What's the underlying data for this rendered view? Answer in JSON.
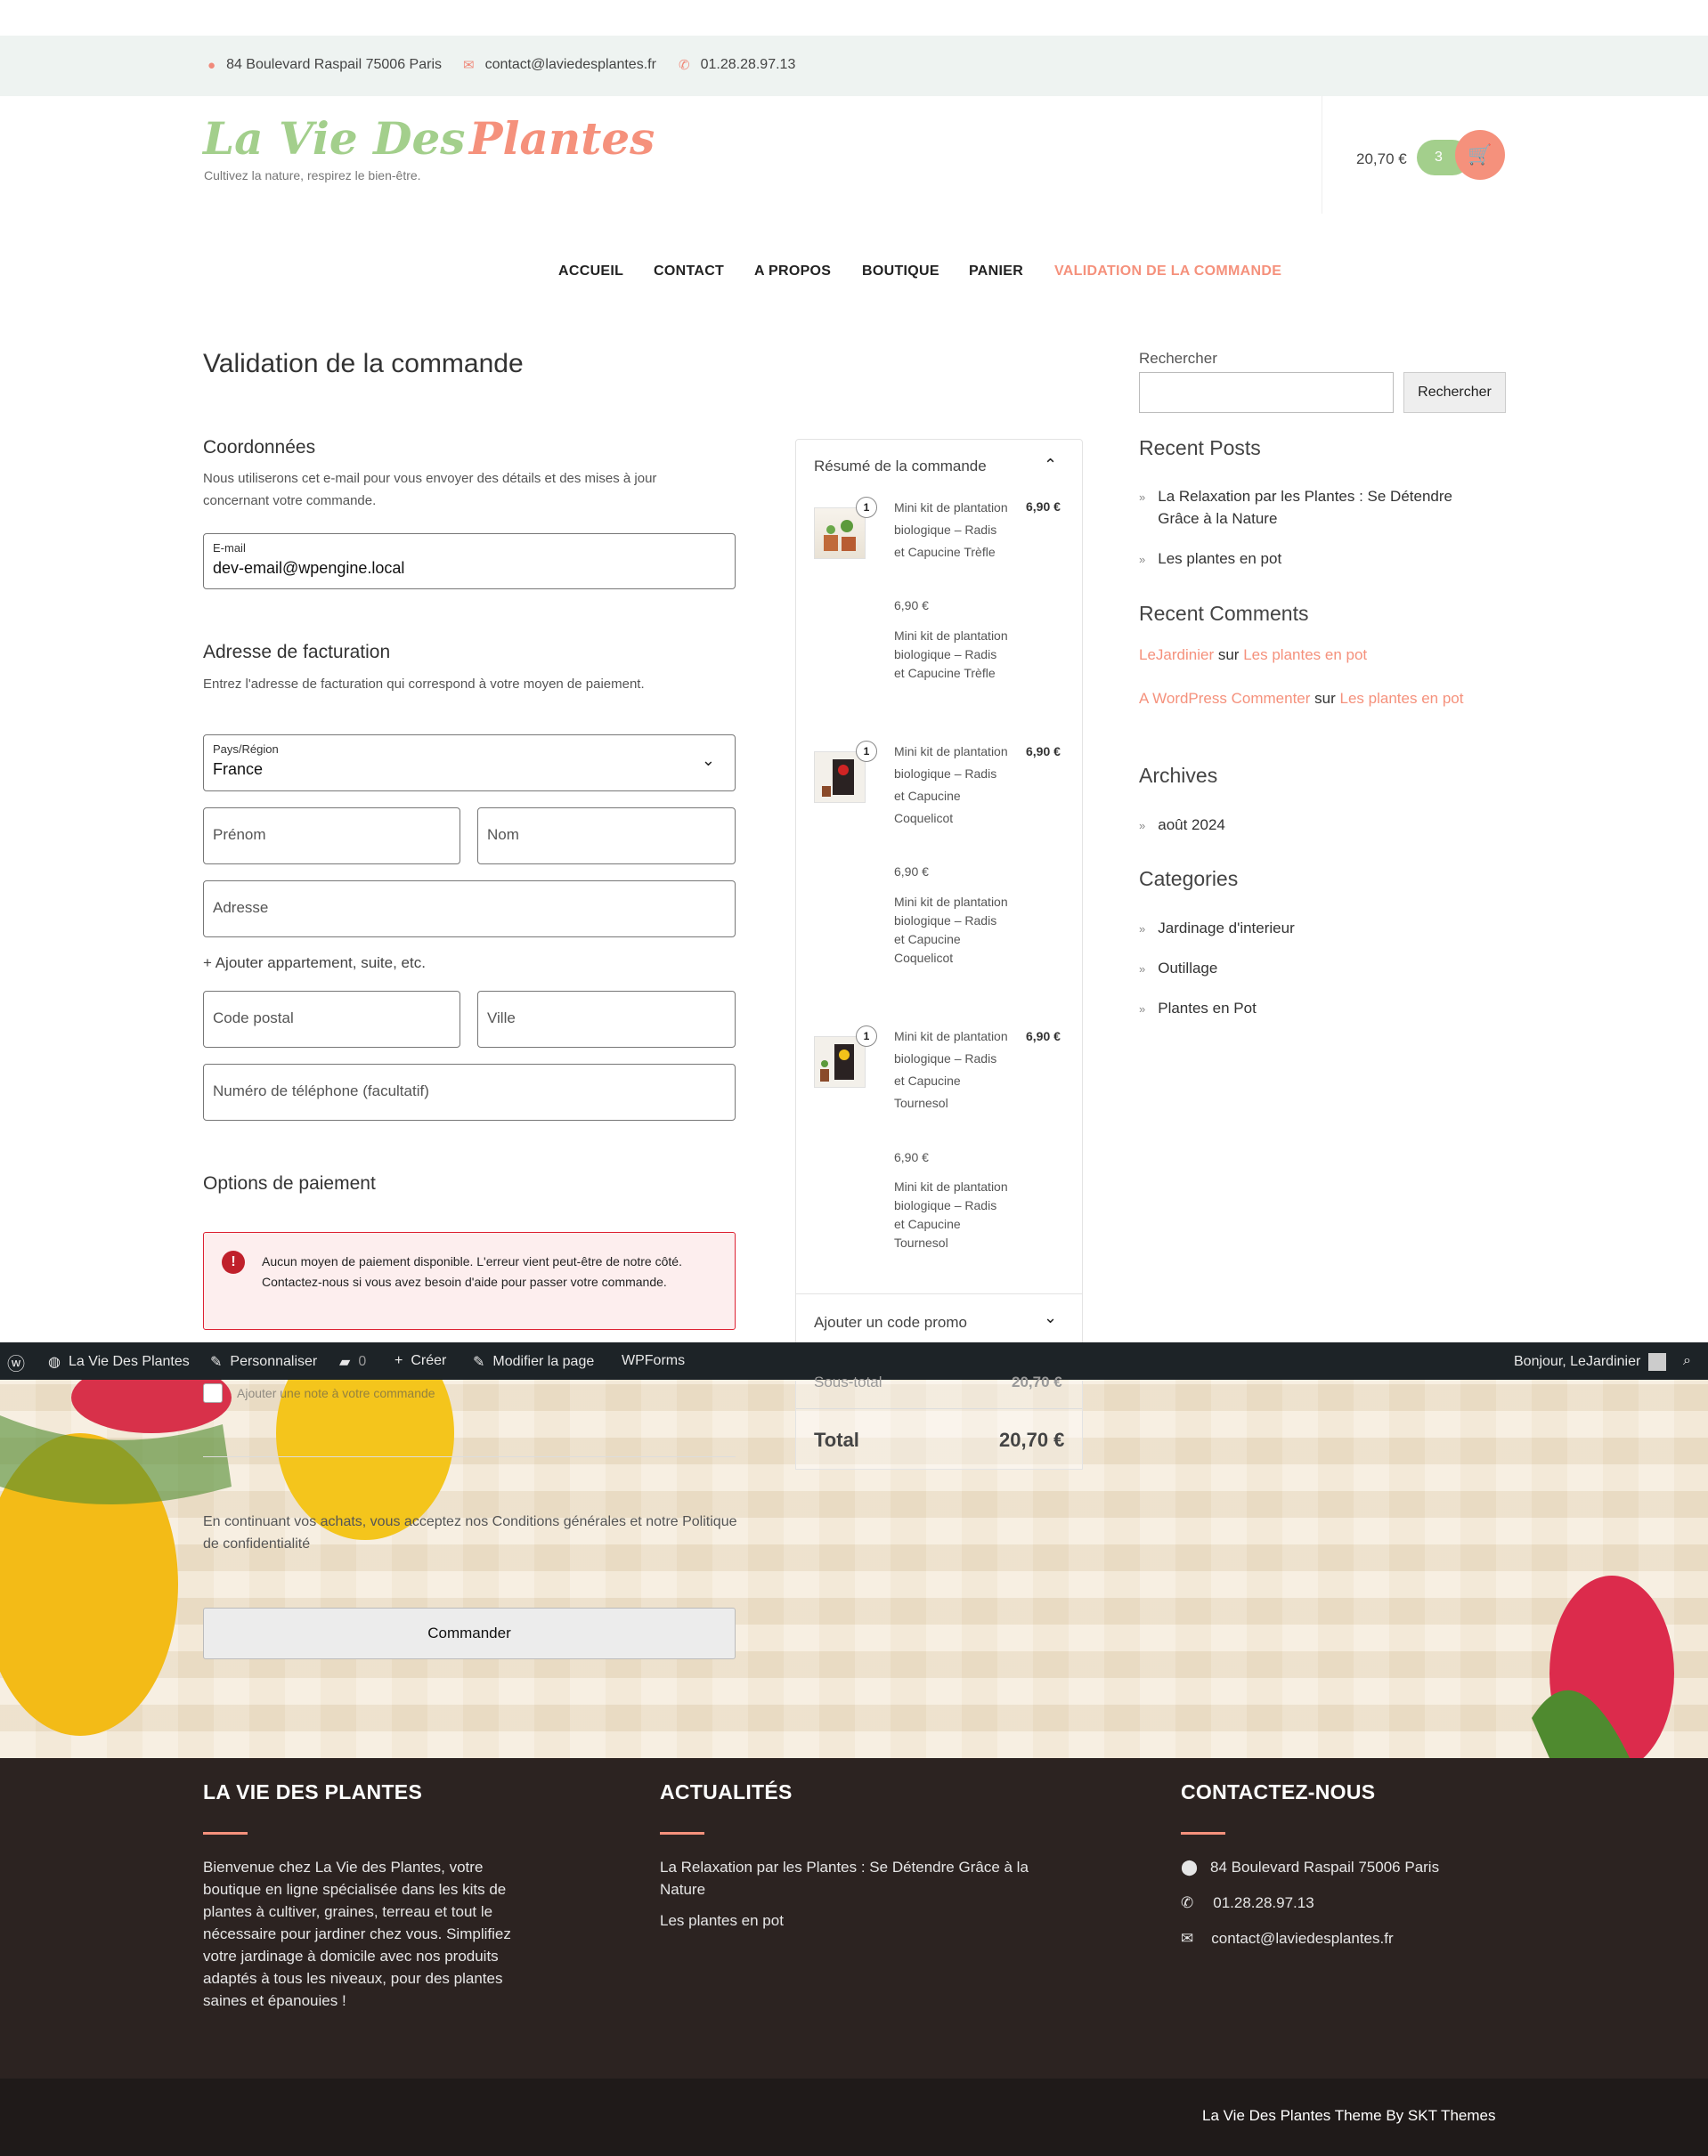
{
  "topbar": {
    "address": "84 Boulevard Raspail 75006 Paris",
    "email": "contact@laviedesplantes.fr",
    "phone": "01.28.28.97.13"
  },
  "header": {
    "logo_part1": "La Vie Des",
    "logo_part2": "Plantes",
    "tagline": "Cultivez la nature, respirez le bien-être.",
    "cart_total": "20,70 €",
    "cart_count": "3"
  },
  "nav": [
    "ACCUEIL",
    "CONTACT",
    "A PROPOS",
    "BOUTIQUE",
    "PANIER",
    "VALIDATION DE LA COMMANDE"
  ],
  "page_title": "Validation de la commande",
  "contact": {
    "title": "Coordonnées",
    "desc": "Nous utiliserons cet e-mail pour vous envoyer des détails et des mises à jour concernant votre commande.",
    "email_label": "E-mail",
    "email_value": "dev-email@wpengine.local"
  },
  "billing": {
    "title": "Adresse de facturation",
    "desc": "Entrez l'adresse de facturation qui correspond à votre moyen de paiement.",
    "country_label": "Pays/Région",
    "country_value": "France",
    "firstname": "Prénom",
    "lastname": "Nom",
    "address": "Adresse",
    "add_apartment": "+ Ajouter appartement, suite, etc.",
    "postcode": "Code postal",
    "city": "Ville",
    "phone": "Numéro de téléphone (facultatif)"
  },
  "payment": {
    "title": "Options de paiement",
    "error": "Aucun moyen de paiement disponible. L'erreur vient peut-être de notre côté. Contactez-nous si vous avez besoin d'aide pour passer votre commande.",
    "note_checkbox": "Ajouter une note à votre commande",
    "terms": "En continuant vos achats, vous acceptez nos Conditions générales et notre Politique de confidentialité",
    "submit": "Commander"
  },
  "summary": {
    "title": "Résumé de la commande",
    "promo": "Ajouter un code promo",
    "subtotal_label": "Sous-total",
    "subtotal_value": "20,70 €",
    "total_label": "Total",
    "total_value": "20,70 €",
    "items": [
      {
        "qty": "1",
        "name": "Mini kit de plantation biologique – Radis et Capucine Trèfle",
        "price": "6,90 €",
        "unit": "6,90 €",
        "desc": "Mini kit de plantation biologique – Radis et Capucine Trèfle"
      },
      {
        "qty": "1",
        "name": "Mini kit de plantation biologique – Radis et Capucine Coquelicot",
        "price": "6,90 €",
        "unit": "6,90 €",
        "desc": "Mini kit de plantation biologique – Radis et Capucine Coquelicot"
      },
      {
        "qty": "1",
        "name": "Mini kit de plantation biologique – Radis et Capucine Tournesol",
        "price": "6,90 €",
        "unit": "6,90 €",
        "desc": "Mini kit de plantation biologique – Radis et Capucine Tournesol"
      }
    ]
  },
  "sidebar": {
    "search_label": "Rechercher",
    "search_button": "Rechercher",
    "recent_posts_title": "Recent Posts",
    "recent_posts": [
      "La Relaxation par les Plantes : Se Détendre Grâce à la Nature",
      "Les plantes en pot"
    ],
    "recent_comments_title": "Recent Comments",
    "comments": [
      {
        "author": "LeJardinier",
        "sep": "sur",
        "post": "Les plantes en pot"
      },
      {
        "author": "A WordPress Commenter",
        "sep": "sur",
        "post": "Les plantes en pot"
      }
    ],
    "archives_title": "Archives",
    "archives": [
      "août 2024"
    ],
    "categories_title": "Categories",
    "categories": [
      "Jardinage d'interieur",
      "Outillage",
      "Plantes en Pot"
    ]
  },
  "adminbar": {
    "site": "La Vie Des Plantes",
    "customize": "Personnaliser",
    "comments": "0",
    "new": "Créer",
    "edit": "Modifier la page",
    "wpforms": "WPForms",
    "greeting": "Bonjour, LeJardinier"
  },
  "footer": {
    "col1_title": "LA VIE DES PLANTES",
    "col1_text": "Bienvenue chez La Vie des Plantes, votre boutique en ligne spécialisée dans les kits de plantes à cultiver, graines, terreau et tout le nécessaire pour jardiner chez vous. Simplifiez votre jardinage à domicile avec nos produits adaptés à tous les niveaux, pour des plantes saines et épanouies !",
    "col2_title": "ACTUALITÉS",
    "col2_links": [
      "La Relaxation par les Plantes : Se Détendre Grâce à la Nature",
      "Les plantes en pot"
    ],
    "col3_title": "CONTACTEZ-NOUS",
    "col3_address": "84 Boulevard Raspail 75006 Paris",
    "col3_phone": "01.28.28.97.13",
    "col3_email": "contact@laviedesplantes.fr",
    "credit": "La Vie Des Plantes Theme By SKT Themes"
  },
  "colors": {
    "accent": "#f5917c",
    "green": "#a3cf8c",
    "footer_bg": "#2c2321",
    "admin_bg": "#1d2327"
  }
}
